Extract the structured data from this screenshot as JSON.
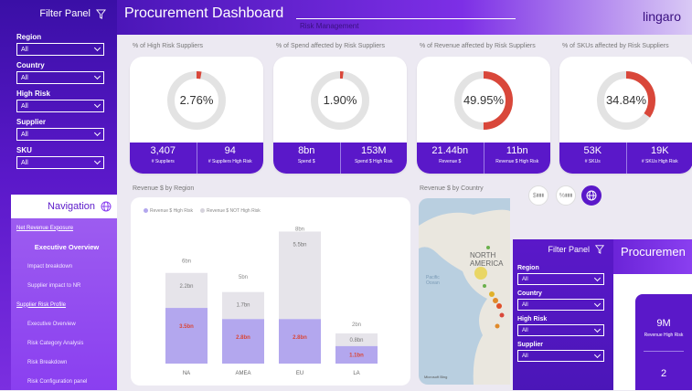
{
  "filter_panel": {
    "title": "Filter Panel",
    "filters": [
      {
        "label": "Region",
        "value": "All"
      },
      {
        "label": "Country",
        "value": "All"
      },
      {
        "label": "High Risk",
        "value": "All"
      },
      {
        "label": "Supplier",
        "value": "All"
      },
      {
        "label": "SKU",
        "value": "All"
      }
    ]
  },
  "navigation": {
    "title": "Navigation",
    "items": [
      {
        "label": "Net Revenue Exposure",
        "kind": "section"
      },
      {
        "label": "Executive Overview",
        "kind": "active"
      },
      {
        "label": "Impact breakdown",
        "kind": "sub"
      },
      {
        "label": "Supplier impact to NR",
        "kind": "sub"
      },
      {
        "label": "Supplier Risk Profile",
        "kind": "section"
      },
      {
        "label": "Executive Overview",
        "kind": "sub"
      },
      {
        "label": "Risk Category Analysis",
        "kind": "sub"
      },
      {
        "label": "Risk Breakdown",
        "kind": "sub"
      },
      {
        "label": "Risk Configuration panel",
        "kind": "sub"
      }
    ]
  },
  "header": {
    "title": "Procurement Dashboard",
    "subtitle": "Risk Management",
    "logo": "lingaro"
  },
  "kpis": [
    {
      "label": "% of High Risk Suppliers",
      "pct": "2.76%",
      "fraction": 0.0276,
      "left_value": "3,407",
      "left_label": "# Suppliers",
      "right_value": "94",
      "right_label": "# Suppliers High Risk"
    },
    {
      "label": "% of Spend affected by Risk Suppliers",
      "pct": "1.90%",
      "fraction": 0.019,
      "left_value": "8bn",
      "left_label": "Spend $",
      "right_value": "153M",
      "right_label": "Spend $ High Risk"
    },
    {
      "label": "% of Revenue affected by Risk Suppliers",
      "pct": "49.95%",
      "fraction": 0.4995,
      "left_value": "21.44bn",
      "left_label": "Revenue $",
      "right_value": "11bn",
      "right_label": "Revenue $ High Risk"
    },
    {
      "label": "% of SKUs affected by Risk Suppliers",
      "pct": "34.84%",
      "fraction": 0.3484,
      "left_value": "53K",
      "left_label": "# SKUs",
      "right_value": "19K",
      "right_label": "# SKUs High Risk"
    }
  ],
  "region_chart_title": "Revenue $ by Region",
  "country_chart_title": "Revenue $ by Country",
  "map_labels": {
    "continent": "NORTH AMERICA",
    "ocean": "Pacific Ocean",
    "credit": "Microsoft Bing"
  },
  "chart_data": {
    "type": "bar",
    "stacked": true,
    "categories": [
      "NA",
      "AMEA",
      "EU",
      "LA"
    ],
    "series": [
      {
        "name": "Revenue $ High Risk",
        "values": [
          3.5,
          2.8,
          2.8,
          1.1
        ],
        "labels": [
          "3.5bn",
          "2.8bn",
          "2.8bn",
          "1.1bn"
        ],
        "color": "#b3a7ee"
      },
      {
        "name": "Revenue $ NOT High Risk",
        "values": [
          2.2,
          1.7,
          5.5,
          0.8
        ],
        "labels": [
          "2.2bn",
          "1.7bn",
          "5.5bn",
          "0.8bn"
        ],
        "color": "#e6e4ea"
      }
    ],
    "totals": [
      "6bn",
      "5bn",
      "8bn",
      "2bn"
    ],
    "total_values": [
      6,
      5,
      8,
      2
    ],
    "ylim": [
      0,
      8.5
    ],
    "legend": "top-left"
  },
  "overlay": {
    "filter_title": "Filter Panel",
    "title": "Procuremen",
    "filters": [
      {
        "label": "Region",
        "value": "All"
      },
      {
        "label": "Country",
        "value": "All"
      },
      {
        "label": "High Risk",
        "value": "All"
      },
      {
        "label": "Supplier",
        "value": "All"
      }
    ],
    "card_value": "9M",
    "card_label": "Revenue High Risk",
    "card_value2": "2"
  },
  "colors": {
    "accent": "#5a18c9",
    "ring_fill": "#d9473a",
    "ring_track": "#e3e3e3"
  }
}
